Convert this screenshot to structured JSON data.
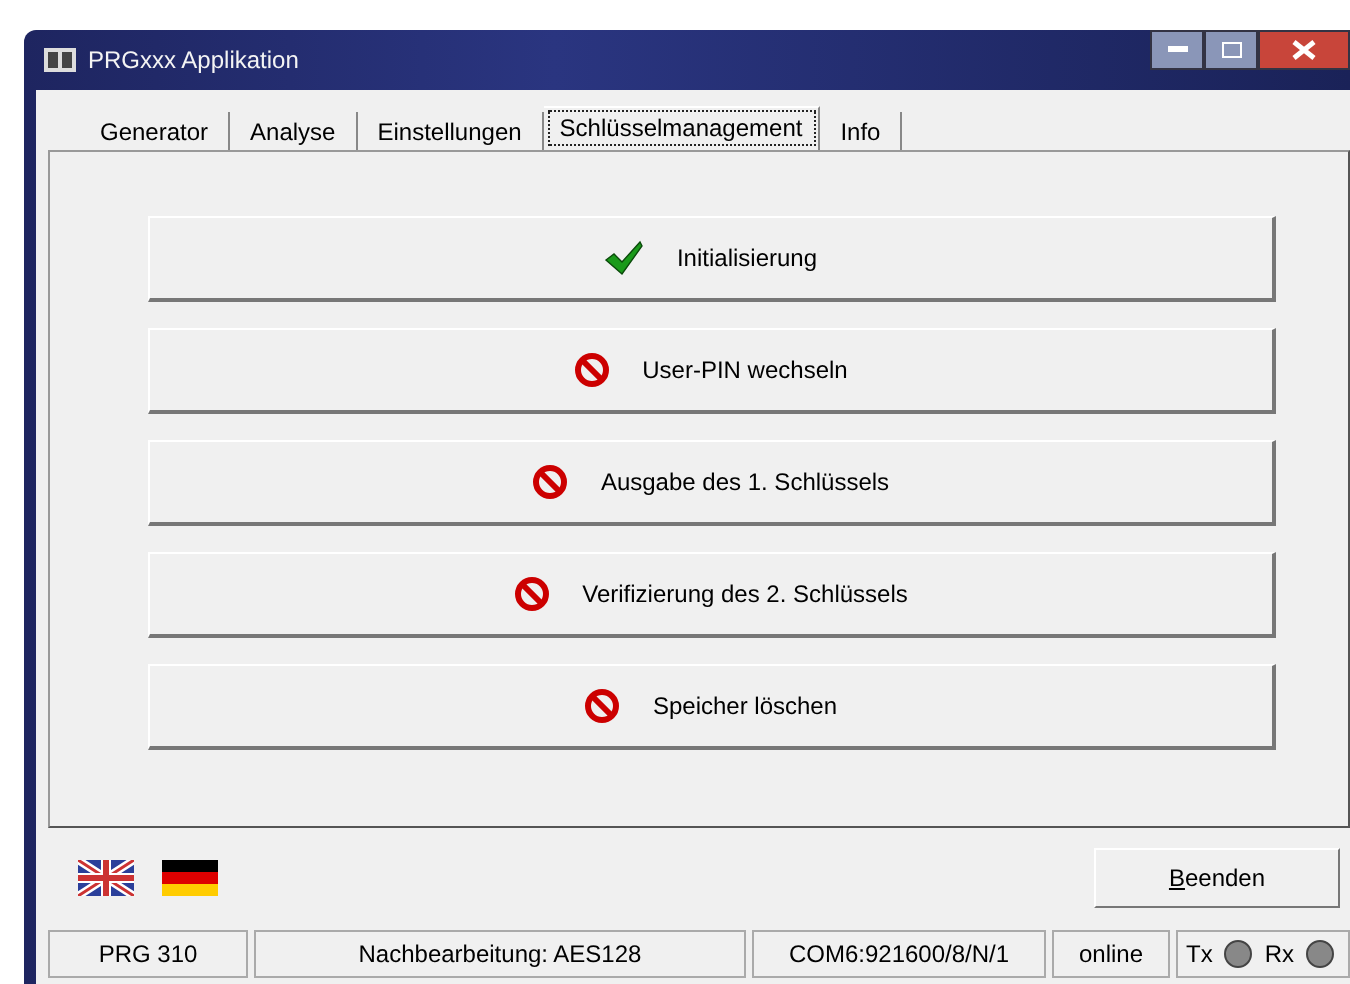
{
  "window": {
    "title": "PRGxxx Applikation"
  },
  "tabs": [
    {
      "label": "Generator",
      "selected": false
    },
    {
      "label": "Analyse",
      "selected": false
    },
    {
      "label": "Einstellungen",
      "selected": false
    },
    {
      "label": "Schlüsselmanagement",
      "selected": true
    },
    {
      "label": "Info",
      "selected": false
    }
  ],
  "actions": [
    {
      "label": "Initialisierung",
      "kind": "done"
    },
    {
      "label": "User-PIN wechseln",
      "kind": "blocked"
    },
    {
      "label": "Ausgabe des 1. Schlüssels",
      "kind": "blocked"
    },
    {
      "label": "Verifizierung des 2. Schlüssels",
      "kind": "blocked"
    },
    {
      "label": "Speicher löschen",
      "kind": "blocked"
    }
  ],
  "languages": [
    {
      "kind": "uk"
    },
    {
      "kind": "de"
    }
  ],
  "exit_button": "Beenden",
  "status_bar": {
    "device": "PRG 310",
    "mode": "Nachbearbeitung: AES128",
    "port": "COM6:921600/8/N/1",
    "connection": "online",
    "leds": [
      {
        "label": "Tx",
        "lit": false
      },
      {
        "label": "Rx",
        "lit": false
      }
    ]
  }
}
